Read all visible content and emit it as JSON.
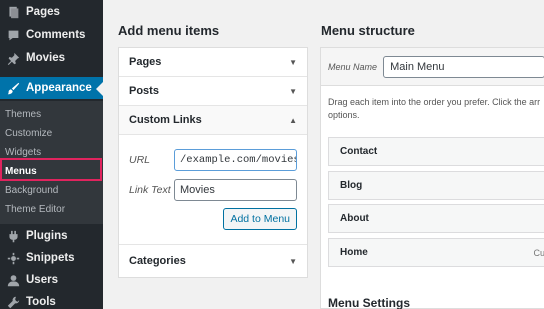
{
  "sidebar": {
    "items": [
      {
        "label": "Pages",
        "icon": "pages-icon"
      },
      {
        "label": "Comments",
        "icon": "comments-icon"
      },
      {
        "label": "Movies",
        "icon": "pin-icon"
      },
      {
        "label": "Appearance",
        "icon": "brush-icon",
        "active": true
      },
      {
        "label": "Plugins",
        "icon": "plugin-icon"
      },
      {
        "label": "Snippets",
        "icon": "snippets-icon"
      },
      {
        "label": "Users",
        "icon": "users-icon"
      },
      {
        "label": "Tools",
        "icon": "wrench-icon"
      }
    ],
    "submenu": [
      "Themes",
      "Customize",
      "Widgets",
      "Menus",
      "Background",
      "Theme Editor"
    ],
    "current_submenu": "Menus"
  },
  "add_items": {
    "title": "Add menu items",
    "sections": [
      "Pages",
      "Posts",
      "Custom Links",
      "Categories"
    ],
    "custom_links": {
      "url_label": "URL",
      "url_value": "/example.com/movies",
      "link_text_label": "Link Text",
      "link_text_value": "Movies",
      "button": "Add to Menu"
    }
  },
  "structure": {
    "title": "Menu structure",
    "menu_name_label": "Menu Name",
    "menu_name_value": "Main Menu",
    "instructions_1": "Drag each item into the order you prefer. Click the arr",
    "instructions_2": "options.",
    "items": [
      {
        "label": "Contact",
        "type": ""
      },
      {
        "label": "Blog",
        "type": ""
      },
      {
        "label": "About",
        "type": ""
      },
      {
        "label": "Home",
        "type": "Cu"
      }
    ],
    "settings_title": "Menu Settings"
  },
  "colors": {
    "sidebar_bg": "#23282d",
    "active_bg": "#0073aa",
    "highlight": "#e0245e"
  }
}
